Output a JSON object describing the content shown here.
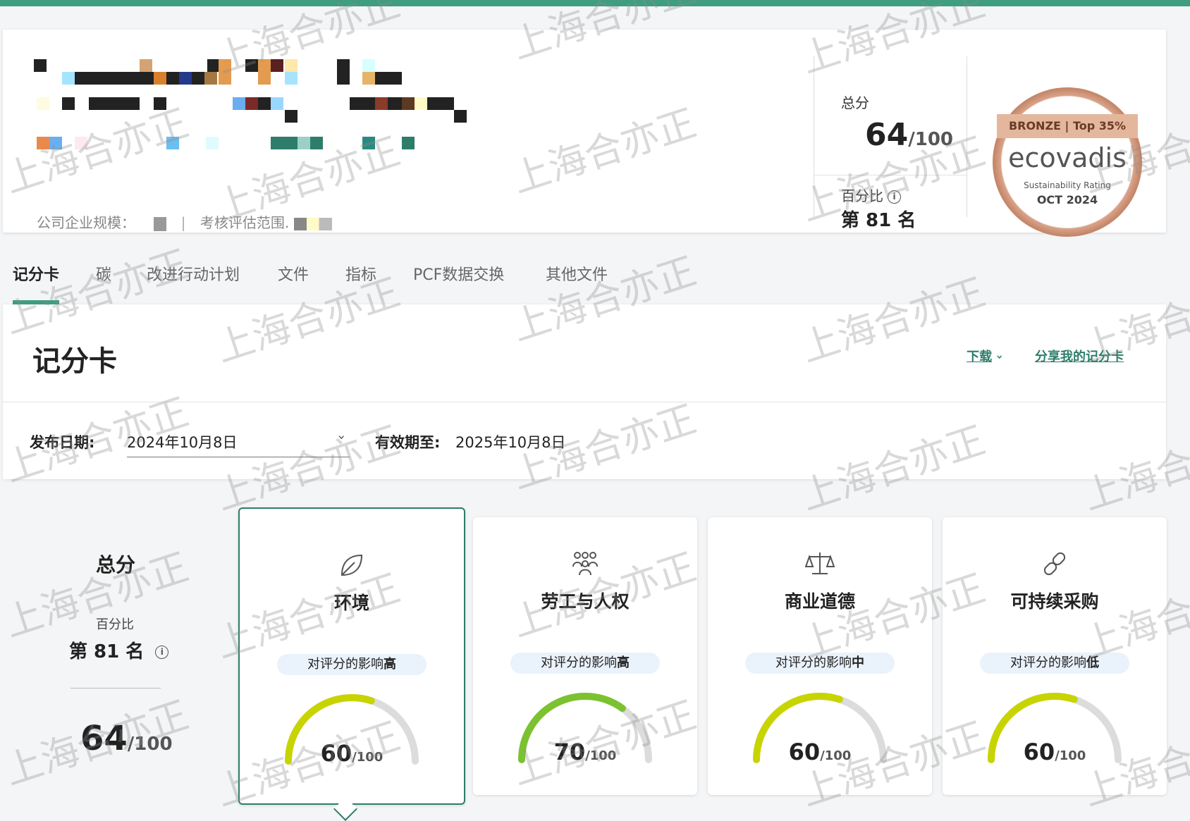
{
  "header": {
    "meta_scale_label": "公司企业规模：",
    "meta_separator": "|",
    "meta_scope_label": "考核评估范围.",
    "score": {
      "label": "总分",
      "value": "64",
      "denominator": "/100",
      "percentile_label": "百分比",
      "rank": "第 81 名"
    },
    "badge": {
      "tier": "BRONZE | Top 35%",
      "brand": "ecovadis",
      "subtitle": "Sustainability Rating",
      "date": "OCT 2024"
    }
  },
  "tabs": [
    {
      "label": "记分卡",
      "active": true
    },
    {
      "label": "碳",
      "active": false
    },
    {
      "label": "改进行动计划",
      "active": false
    },
    {
      "label": "文件",
      "active": false
    },
    {
      "label": "指标",
      "active": false
    },
    {
      "label": "PCF数据交换",
      "active": false
    },
    {
      "label": "其他文件",
      "active": false
    }
  ],
  "scorecard": {
    "title": "记分卡",
    "download_label": "下载",
    "share_label": "分享我的记分卡",
    "publish_label": "发布日期:",
    "publish_value": "2024年10月8日",
    "valid_label": "有效期至:",
    "valid_value": "2025年10月8日"
  },
  "summary": {
    "title": "总分",
    "percentile_label": "百分比",
    "rank": "第 81 名",
    "score": "64",
    "denominator": "/100"
  },
  "themes": [
    {
      "title": "环境",
      "impact_prefix": "对评分的影响",
      "impact_level": "高",
      "score": 60,
      "denominator": "/100",
      "icon": "leaf-icon",
      "color": "#c8d400",
      "selected": true
    },
    {
      "title": "劳工与人权",
      "impact_prefix": "对评分的影响",
      "impact_level": "高",
      "score": 70,
      "denominator": "/100",
      "icon": "people-icon",
      "color": "#7cc230",
      "selected": false
    },
    {
      "title": "商业道德",
      "impact_prefix": "对评分的影响",
      "impact_level": "中",
      "score": 60,
      "denominator": "/100",
      "icon": "scale-icon",
      "color": "#c8d400",
      "selected": false
    },
    {
      "title": "可持续采购",
      "impact_prefix": "对评分的影响",
      "impact_level": "低",
      "score": 60,
      "denominator": "/100",
      "icon": "link-icon",
      "color": "#c8d400",
      "selected": false
    }
  ],
  "watermark": "上海合亦正",
  "colors": {
    "accent": "#3e9e7e",
    "link": "#2e7d6b",
    "gauge_track": "#dcdcdc"
  }
}
